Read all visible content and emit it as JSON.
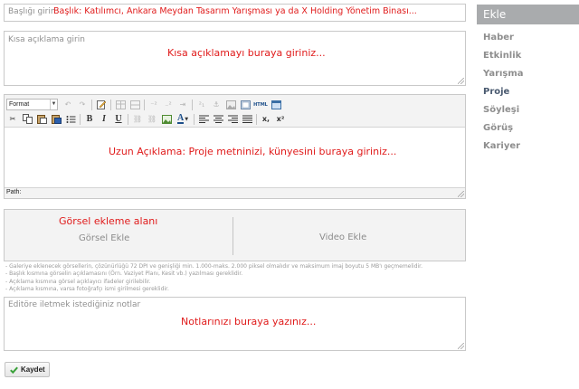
{
  "title_field": {
    "placeholder": "Başlığı girin",
    "annotation": "Başlık: Katılımcı, Ankara Meydan Tasarım Yarışması ya da X Holding Yönetim Binası..."
  },
  "short_description": {
    "placeholder": "Kısa açıklama girin",
    "annotation": "Kısa açıklamayı buraya giriniz..."
  },
  "editor": {
    "format_select": "Format",
    "annotation": "Uzun Açıklama: Proje metninizi, künyesini buraya giriniz...",
    "path_label": "Path:",
    "toolbar_icons_row1": [
      "undo-icon",
      "redo-icon",
      "edit-icon",
      "table-icon",
      "table-row-icon",
      "superscript-icon",
      "subscript-icon",
      "indent-icon",
      "special-char-icon",
      "anchor-icon",
      "image-icon",
      "media-icon",
      "html-icon",
      "preview-icon"
    ],
    "toolbar_icons_row2": [
      "cut-icon",
      "copy-icon",
      "paste-icon",
      "paste-word-icon",
      "list-icon",
      "bold-icon",
      "italic-icon",
      "underline-icon",
      "link-icon",
      "unlink-icon",
      "image-insert-icon",
      "font-color-icon",
      "align-left-icon",
      "align-center-icon",
      "align-right-icon",
      "justify-icon",
      "remove-format-icon",
      "superscript-x-icon"
    ],
    "toolbar_text": {
      "bold": "B",
      "italic": "I",
      "underline": "U",
      "font_color": "A",
      "html": "HTML",
      "remove_format": "x,",
      "superscript": "x²"
    }
  },
  "media": {
    "annotation": "Görsel ekleme alanı",
    "image_add": "Görsel Ekle",
    "video_add": "Video Ekle"
  },
  "info_notes": [
    "- Galeriye eklenecek görsellerin, çözünürlüğü 72 DPI ve genişliği min. 1.000-maks. 2.000 piksel olmalıdır ve maksimum imaj boyutu 5 MB'ı geçmemelidir.",
    "- Başlık kısmına görselin açıklamasını (Örn. Vaziyet Planı, Kesit vb.) yazılması gereklidir.",
    "- Açıklama kısmına görsel açıklayıcı ifadeler girilebilir.",
    "- Açıklama kısmına, varsa fotoğrafçı ismi girilmesi gereklidir."
  ],
  "editor_notes": {
    "placeholder": "Editöre iletmek istediğiniz notlar",
    "annotation": "Notlarınızı buraya yazınız..."
  },
  "save_button": {
    "label": "Kaydet",
    "icon": "check-icon"
  },
  "sidebar": {
    "header": "Ekle",
    "items": [
      {
        "label": "Haber"
      },
      {
        "label": "Etkinlik"
      },
      {
        "label": "Yarışma"
      },
      {
        "label": "Proje"
      },
      {
        "label": "Söyleşi"
      },
      {
        "label": "Görüş"
      },
      {
        "label": "Kariyer"
      }
    ],
    "active": "Proje"
  },
  "colors": {
    "annotation": "#e01b1b",
    "sidebar_header_bg": "#a9abad",
    "sidebar_active": "#4a5a70",
    "sidebar_item": "#8e8e8e",
    "check": "#3aa13a"
  }
}
